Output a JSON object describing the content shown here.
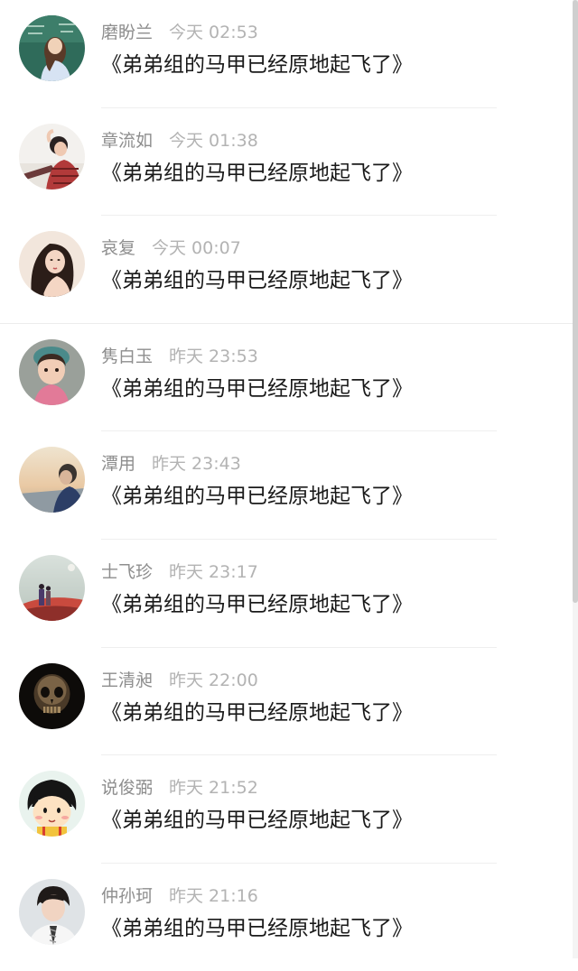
{
  "comments": [
    {
      "name": "磨盼兰",
      "time": "今天 02:53",
      "text": "《弟弟组的马甲已经原地起飞了》",
      "avatar": "teacher-avatar-icon"
    },
    {
      "name": "章流如",
      "time": "今天 01:38",
      "text": "《弟弟组的马甲已经原地起飞了》",
      "avatar": "stretching-person-avatar-icon"
    },
    {
      "name": "哀复",
      "time": "今天 00:07",
      "text": "《弟弟组的马甲已经原地起飞了》",
      "avatar": "woman-portrait-avatar-icon"
    },
    {
      "name": "隽白玉",
      "time": "昨天 23:53",
      "text": "《弟弟组的马甲已经原地起飞了》",
      "avatar": "child-avatar-icon"
    },
    {
      "name": "潭用",
      "time": "昨天 23:43",
      "text": "《弟弟组的马甲已经原地起飞了》",
      "avatar": "sunset-person-avatar-icon"
    },
    {
      "name": "士飞珍",
      "time": "昨天 23:17",
      "text": "《弟弟组的马甲已经原地起飞了》",
      "avatar": "couple-landscape-avatar-icon"
    },
    {
      "name": "王清昶",
      "time": "昨天 22:00",
      "text": "《弟弟组的马甲已经原地起飞了》",
      "avatar": "skull-avatar-icon"
    },
    {
      "name": "说俊弼",
      "time": "昨天 21:52",
      "text": "《弟弟组的马甲已经原地起飞了》",
      "avatar": "cartoon-girl-avatar-icon"
    },
    {
      "name": "仲孙珂",
      "time": "昨天 21:16",
      "text": "《弟弟组的马甲已经原地起飞了》",
      "avatar": "young-man-avatar-icon"
    }
  ],
  "colors": {
    "name": "#8e8e8e",
    "time": "#b3b3b3",
    "text": "#1a1a1a",
    "divider": "#efefef"
  }
}
